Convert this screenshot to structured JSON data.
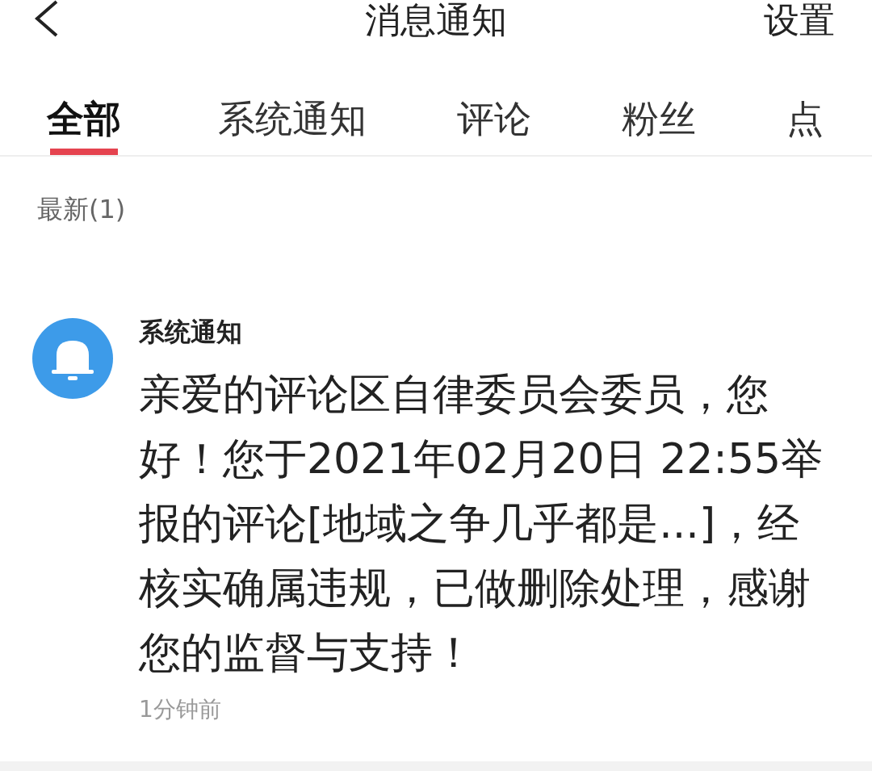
{
  "header": {
    "title": "消息通知",
    "action": "设置"
  },
  "tabs": [
    {
      "label": "全部",
      "selected": true
    },
    {
      "label": "系统通知",
      "selected": false
    },
    {
      "label": "评论",
      "selected": false
    },
    {
      "label": "粉丝",
      "selected": false
    },
    {
      "label": "点",
      "selected": false
    }
  ],
  "section_title": "最新(1)",
  "notifications": [
    {
      "sender": "系统通知",
      "message": "亲爱的评论区自律委员会委员，您好！您于2021年02月20日 22:55举报的评论[地域之争几乎都是...]，经核实确属违规，已做删除处理，感谢您的监督与支持！",
      "time": "1分钟前"
    }
  ]
}
